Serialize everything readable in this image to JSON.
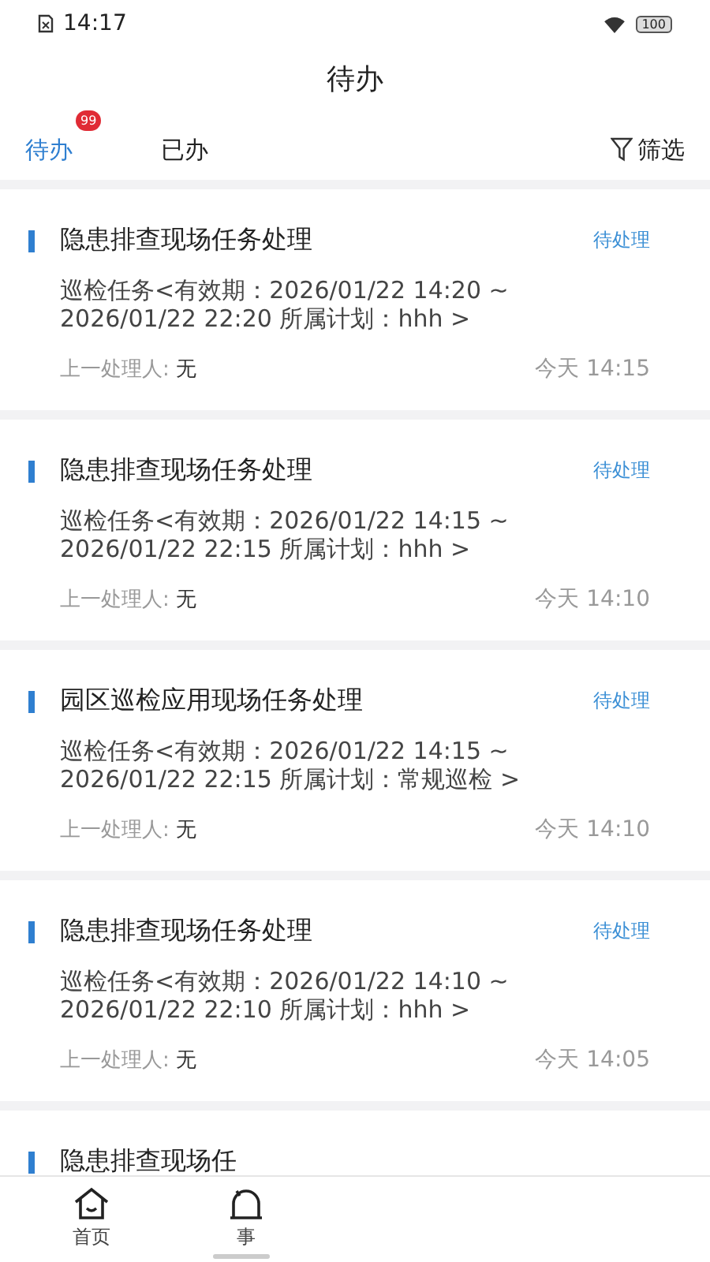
{
  "status_bar": {
    "time": "14:17",
    "battery": "100"
  },
  "header": {
    "title": "待办"
  },
  "tabs": [
    {
      "label": "待办",
      "selected": true,
      "badge": "99"
    },
    {
      "label": "已办",
      "selected": false
    }
  ],
  "filter": {
    "label": "筛选"
  },
  "tasks": [
    {
      "title": "隐患排查现场任务处理",
      "status": "待处理",
      "detail": "巡检任务<有效期：2026/01/22 14:20 ~ 2026/01/22 22:20 所属计划：hhh >",
      "handler_label": "上一处理人:",
      "handler": "无",
      "time": "今天 14:15"
    },
    {
      "title": "隐患排查现场任务处理",
      "status": "待处理",
      "detail": "巡检任务<有效期：2026/01/22 14:15 ~ 2026/01/22 22:15 所属计划：hhh >",
      "handler_label": "上一处理人:",
      "handler": "无",
      "time": "今天 14:10"
    },
    {
      "title": "园区巡检应用现场任务处理",
      "status": "待处理",
      "detail": "巡检任务<有效期：2026/01/22 14:15 ~ 2026/01/22 22:15 所属计划：常规巡检 >",
      "handler_label": "上一处理人:",
      "handler": "无",
      "time": "今天 14:10"
    },
    {
      "title": "隐患排查现场任务处理",
      "status": "待处理",
      "detail": "巡检任务<有效期：2026/01/22 14:10 ~ 2026/01/22 22:10 所属计划：hhh >",
      "handler_label": "上一处理人:",
      "handler": "无",
      "time": "今天 14:05"
    },
    {
      "title": "隐患排查现场任"
    }
  ],
  "bottom_nav": [
    {
      "label": "首页",
      "kind": "home"
    },
    {
      "label": "事",
      "kind": "event"
    }
  ]
}
